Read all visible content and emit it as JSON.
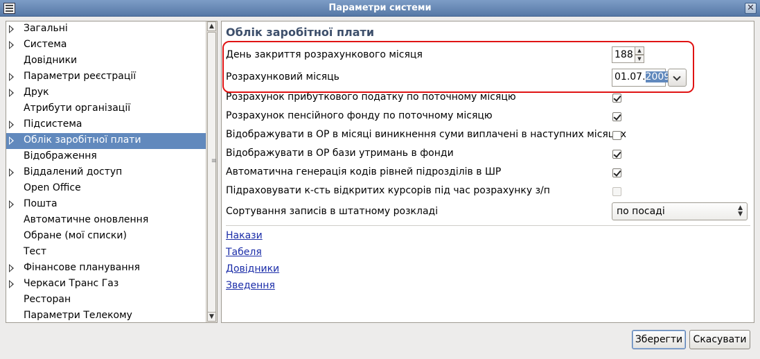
{
  "window": {
    "title": "Параметри системи",
    "close_glyph": "✕"
  },
  "tree": {
    "items": [
      {
        "label": "Загальні",
        "expandable": true
      },
      {
        "label": "Система",
        "expandable": true
      },
      {
        "label": "Довідники",
        "expandable": false
      },
      {
        "label": "Параметри реєстрації",
        "expandable": true
      },
      {
        "label": "Друк",
        "expandable": true
      },
      {
        "label": "Атрибути організації",
        "expandable": false
      },
      {
        "label": "Підсистема",
        "expandable": true
      },
      {
        "label": "Облік заробітної плати",
        "expandable": true,
        "selected": true
      },
      {
        "label": "Відображення",
        "expandable": false
      },
      {
        "label": "Віддалений доступ",
        "expandable": true
      },
      {
        "label": "Open Office",
        "expandable": false
      },
      {
        "label": "Пошта",
        "expandable": true
      },
      {
        "label": "Автоматичне оновлення",
        "expandable": false
      },
      {
        "label": "Обране (мої списки)",
        "expandable": false
      },
      {
        "label": "Тест",
        "expandable": false
      },
      {
        "label": "Фінансове планування",
        "expandable": true
      },
      {
        "label": "Черкаси Транс Газ",
        "expandable": true
      },
      {
        "label": "Ресторан",
        "expandable": false
      },
      {
        "label": "Параметри Телекому",
        "expandable": false
      }
    ]
  },
  "panel": {
    "title": "Облік заробітної плати",
    "closing_day": {
      "label": "День закриття розрахункового місяця",
      "value": "188"
    },
    "calc_month": {
      "label": "Розрахунковий місяць",
      "value_prefix": "01.07.",
      "value_selected": "2009"
    },
    "checkboxes": [
      {
        "label": "Розрахунок прибуткового податку по поточному місяцю",
        "checked": true,
        "enabled": true
      },
      {
        "label": "Розрахунок пенсійного фонду по поточному місяцю",
        "checked": true,
        "enabled": true
      },
      {
        "label": "Відображувати в ОР в місяці виникнення суми виплачені в наступних місяцях",
        "checked": false,
        "enabled": true
      },
      {
        "label": "Відображувати в ОР бази утримань в фонди",
        "checked": true,
        "enabled": true
      },
      {
        "label": "Автоматична генерація кодів рівней підрозділів в ШР",
        "checked": true,
        "enabled": true
      },
      {
        "label": "Підраховувати к-сть відкритих курсорів під час розрахунку з/п",
        "checked": false,
        "enabled": false
      }
    ],
    "sorting": {
      "label": "Сортування записів в штатному розкладі",
      "value": "по посаді"
    },
    "links": [
      "Накази",
      "Табеля",
      "Довідники",
      "Зведення"
    ]
  },
  "buttons": {
    "save": "Зберегти",
    "cancel": "Скасувати"
  }
}
